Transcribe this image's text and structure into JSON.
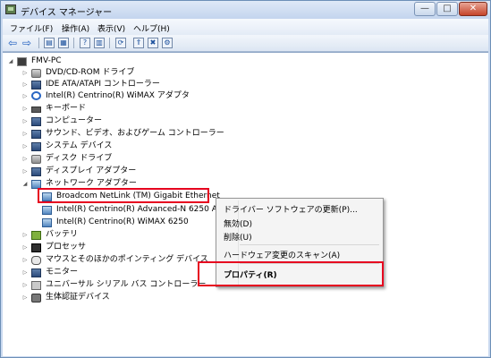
{
  "window": {
    "title": "デバイス マネージャー"
  },
  "window_buttons": {
    "minimize": "—",
    "maximize": "□",
    "close": "✕"
  },
  "menu": [
    {
      "label": "ファイル(F)"
    },
    {
      "label": "操作(A)"
    },
    {
      "label": "表示(V)"
    },
    {
      "label": "ヘルプ(H)"
    }
  ],
  "toolbar": {
    "back": "⇦",
    "forward": "⇨",
    "buttons": [
      "▤",
      "▦",
      "?",
      "▥",
      "⟳",
      "⇑",
      "✖",
      "⚙"
    ]
  },
  "tree": {
    "root": "FMV-PC",
    "categories": [
      {
        "label": "DVD/CD-ROM ドライブ",
        "icon": "drive-icon"
      },
      {
        "label": "IDE ATA/ATAPI コントローラー",
        "icon": "controller-icon"
      },
      {
        "label": "Intel(R) Centrino(R) WiMAX アダプタ",
        "icon": "wimax-icon"
      },
      {
        "label": "キーボード",
        "icon": "keyboard-icon"
      },
      {
        "label": "コンピューター",
        "icon": "computer-icon"
      },
      {
        "label": "サウンド、ビデオ、およびゲーム コントローラー",
        "icon": "sound-icon"
      },
      {
        "label": "システム デバイス",
        "icon": "system-icon"
      },
      {
        "label": "ディスク ドライブ",
        "icon": "disk-icon"
      },
      {
        "label": "ディスプレイ アダプター",
        "icon": "display-icon"
      },
      {
        "label": "ネットワーク アダプター",
        "icon": "network-icon"
      }
    ],
    "network_children": [
      {
        "label": "Broadcom NetLink (TM) Gigabit Ethernet"
      },
      {
        "label": "Intel(R) Centrino(R) Advanced-N 6250 A"
      },
      {
        "label": "Intel(R) Centrino(R) WiMAX 6250"
      }
    ],
    "categories_after": [
      {
        "label": "バッテリ",
        "icon": "battery-icon"
      },
      {
        "label": "プロセッサ",
        "icon": "processor-icon"
      },
      {
        "label": "マウスとそのほかのポインティング デバイス",
        "icon": "mouse-icon"
      },
      {
        "label": "モニター",
        "icon": "monitor-icon"
      },
      {
        "label": "ユニバーサル シリアル バス コントローラー",
        "icon": "usb-icon"
      },
      {
        "label": "生体認証デバイス",
        "icon": "biometric-icon"
      }
    ]
  },
  "context_menu": {
    "items": [
      {
        "label": "ドライバー ソフトウェアの更新(P)..."
      },
      {
        "label": "無効(D)"
      },
      {
        "label": "削除(U)"
      },
      {
        "label": "ハードウェア変更のスキャン(A)"
      },
      {
        "label": "プロパティ(R)"
      }
    ]
  },
  "colors": {
    "highlight_border": "#e6001f",
    "title_bg": "#c9d9ef"
  }
}
